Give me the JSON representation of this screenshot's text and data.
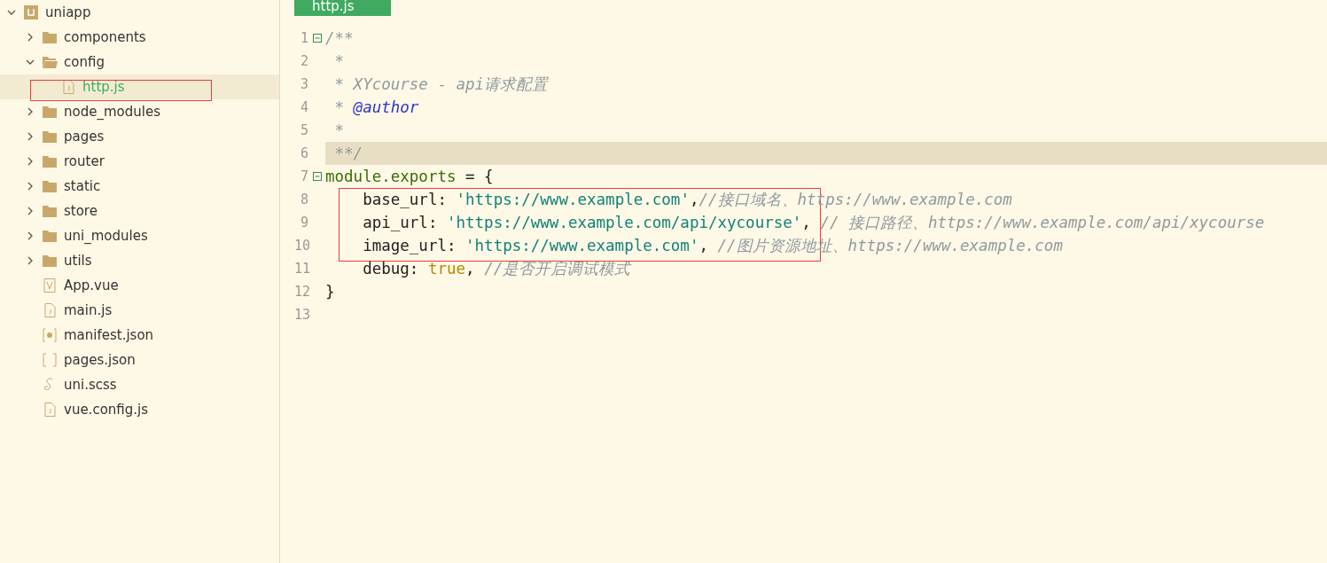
{
  "tree": {
    "label": "uniapp",
    "kind": "project",
    "expanded": true,
    "children": [
      {
        "label": "components",
        "kind": "folder",
        "expanded": false,
        "selected": false,
        "outlined": false
      },
      {
        "label": "config",
        "kind": "folder",
        "expanded": true,
        "selected": false,
        "outlined": false,
        "children": [
          {
            "label": "http.js",
            "kind": "js",
            "selected": true,
            "outlined": true
          }
        ]
      },
      {
        "label": "node_modules",
        "kind": "folder",
        "expanded": false,
        "selected": false,
        "outlined": false
      },
      {
        "label": "pages",
        "kind": "folder",
        "expanded": false,
        "selected": false,
        "outlined": false
      },
      {
        "label": "router",
        "kind": "folder",
        "expanded": false,
        "selected": false,
        "outlined": false
      },
      {
        "label": "static",
        "kind": "folder",
        "expanded": false,
        "selected": false,
        "outlined": false
      },
      {
        "label": "store",
        "kind": "folder",
        "expanded": false,
        "selected": false,
        "outlined": false
      },
      {
        "label": "uni_modules",
        "kind": "folder",
        "expanded": false,
        "selected": false,
        "outlined": false
      },
      {
        "label": "utils",
        "kind": "folder",
        "expanded": false,
        "selected": false,
        "outlined": false
      },
      {
        "label": "App.vue",
        "kind": "vue",
        "selected": false,
        "outlined": false
      },
      {
        "label": "main.js",
        "kind": "js",
        "selected": false,
        "outlined": false
      },
      {
        "label": "manifest.json",
        "kind": "manifest",
        "selected": false,
        "outlined": false
      },
      {
        "label": "pages.json",
        "kind": "json",
        "selected": false,
        "outlined": false
      },
      {
        "label": "uni.scss",
        "kind": "scss",
        "selected": false,
        "outlined": false
      },
      {
        "label": "vue.config.js",
        "kind": "js",
        "selected": false,
        "outlined": false
      }
    ]
  },
  "tab": {
    "label": "http.js",
    "selected": true
  },
  "code": [
    {
      "number": "1",
      "collapsible": true,
      "highlighted": false,
      "outlined": false,
      "tokens": [
        {
          "kind": "comment",
          "text": "/**"
        }
      ]
    },
    {
      "number": "2",
      "collapsible": false,
      "highlighted": false,
      "outlined": false,
      "tokens": [
        {
          "kind": "comment",
          "text": " *"
        }
      ]
    },
    {
      "number": "3",
      "collapsible": false,
      "highlighted": false,
      "outlined": false,
      "tokens": [
        {
          "kind": "comment",
          "text": " * XYcourse - api请求配置"
        }
      ]
    },
    {
      "number": "4",
      "collapsible": false,
      "highlighted": false,
      "outlined": false,
      "tokens": [
        {
          "kind": "comment",
          "text": " * "
        },
        {
          "kind": "tag",
          "text": "@author"
        }
      ]
    },
    {
      "number": "5",
      "collapsible": false,
      "highlighted": false,
      "outlined": false,
      "tokens": [
        {
          "kind": "comment",
          "text": " *"
        }
      ]
    },
    {
      "number": "6",
      "collapsible": false,
      "highlighted": true,
      "outlined": false,
      "tokens": [
        {
          "kind": "comment",
          "text": " **/"
        }
      ]
    },
    {
      "number": "7",
      "collapsible": true,
      "highlighted": false,
      "outlined": false,
      "tokens": [
        {
          "kind": "module",
          "text": "module.exports"
        },
        {
          "kind": "plain",
          "text": " = {"
        }
      ]
    },
    {
      "number": "8",
      "collapsible": false,
      "highlighted": false,
      "outlined": true,
      "tokens": [
        {
          "kind": "plain",
          "text": "    base_url: "
        },
        {
          "kind": "string",
          "text": "'https://www.example.com'"
        },
        {
          "kind": "plain",
          "text": ","
        },
        {
          "kind": "comment",
          "text": "//接口域名、https://www.example.com"
        }
      ]
    },
    {
      "number": "9",
      "collapsible": false,
      "highlighted": false,
      "outlined": true,
      "tokens": [
        {
          "kind": "plain",
          "text": "    api_url: "
        },
        {
          "kind": "string",
          "text": "'https://www.example.com/api/xycourse'"
        },
        {
          "kind": "plain",
          "text": ", "
        },
        {
          "kind": "comment",
          "text": "// 接口路径、https://www.example.com/api/xycourse"
        }
      ]
    },
    {
      "number": "10",
      "collapsible": false,
      "highlighted": false,
      "outlined": true,
      "tokens": [
        {
          "kind": "plain",
          "text": "    image_url: "
        },
        {
          "kind": "string",
          "text": "'https://www.example.com'"
        },
        {
          "kind": "plain",
          "text": ", "
        },
        {
          "kind": "comment",
          "text": "//图片资源地址、https://www.example.com"
        }
      ]
    },
    {
      "number": "11",
      "collapsible": false,
      "highlighted": false,
      "outlined": false,
      "tokens": [
        {
          "kind": "plain",
          "text": "    debug: "
        },
        {
          "kind": "keyword",
          "text": "true"
        },
        {
          "kind": "plain",
          "text": ", "
        },
        {
          "kind": "comment",
          "text": "//是否开启调试模式"
        }
      ]
    },
    {
      "number": "12",
      "collapsible": false,
      "highlighted": false,
      "outlined": false,
      "tokens": [
        {
          "kind": "plain",
          "text": "}"
        }
      ]
    },
    {
      "number": "13",
      "collapsible": false,
      "highlighted": false,
      "outlined": false
    }
  ]
}
